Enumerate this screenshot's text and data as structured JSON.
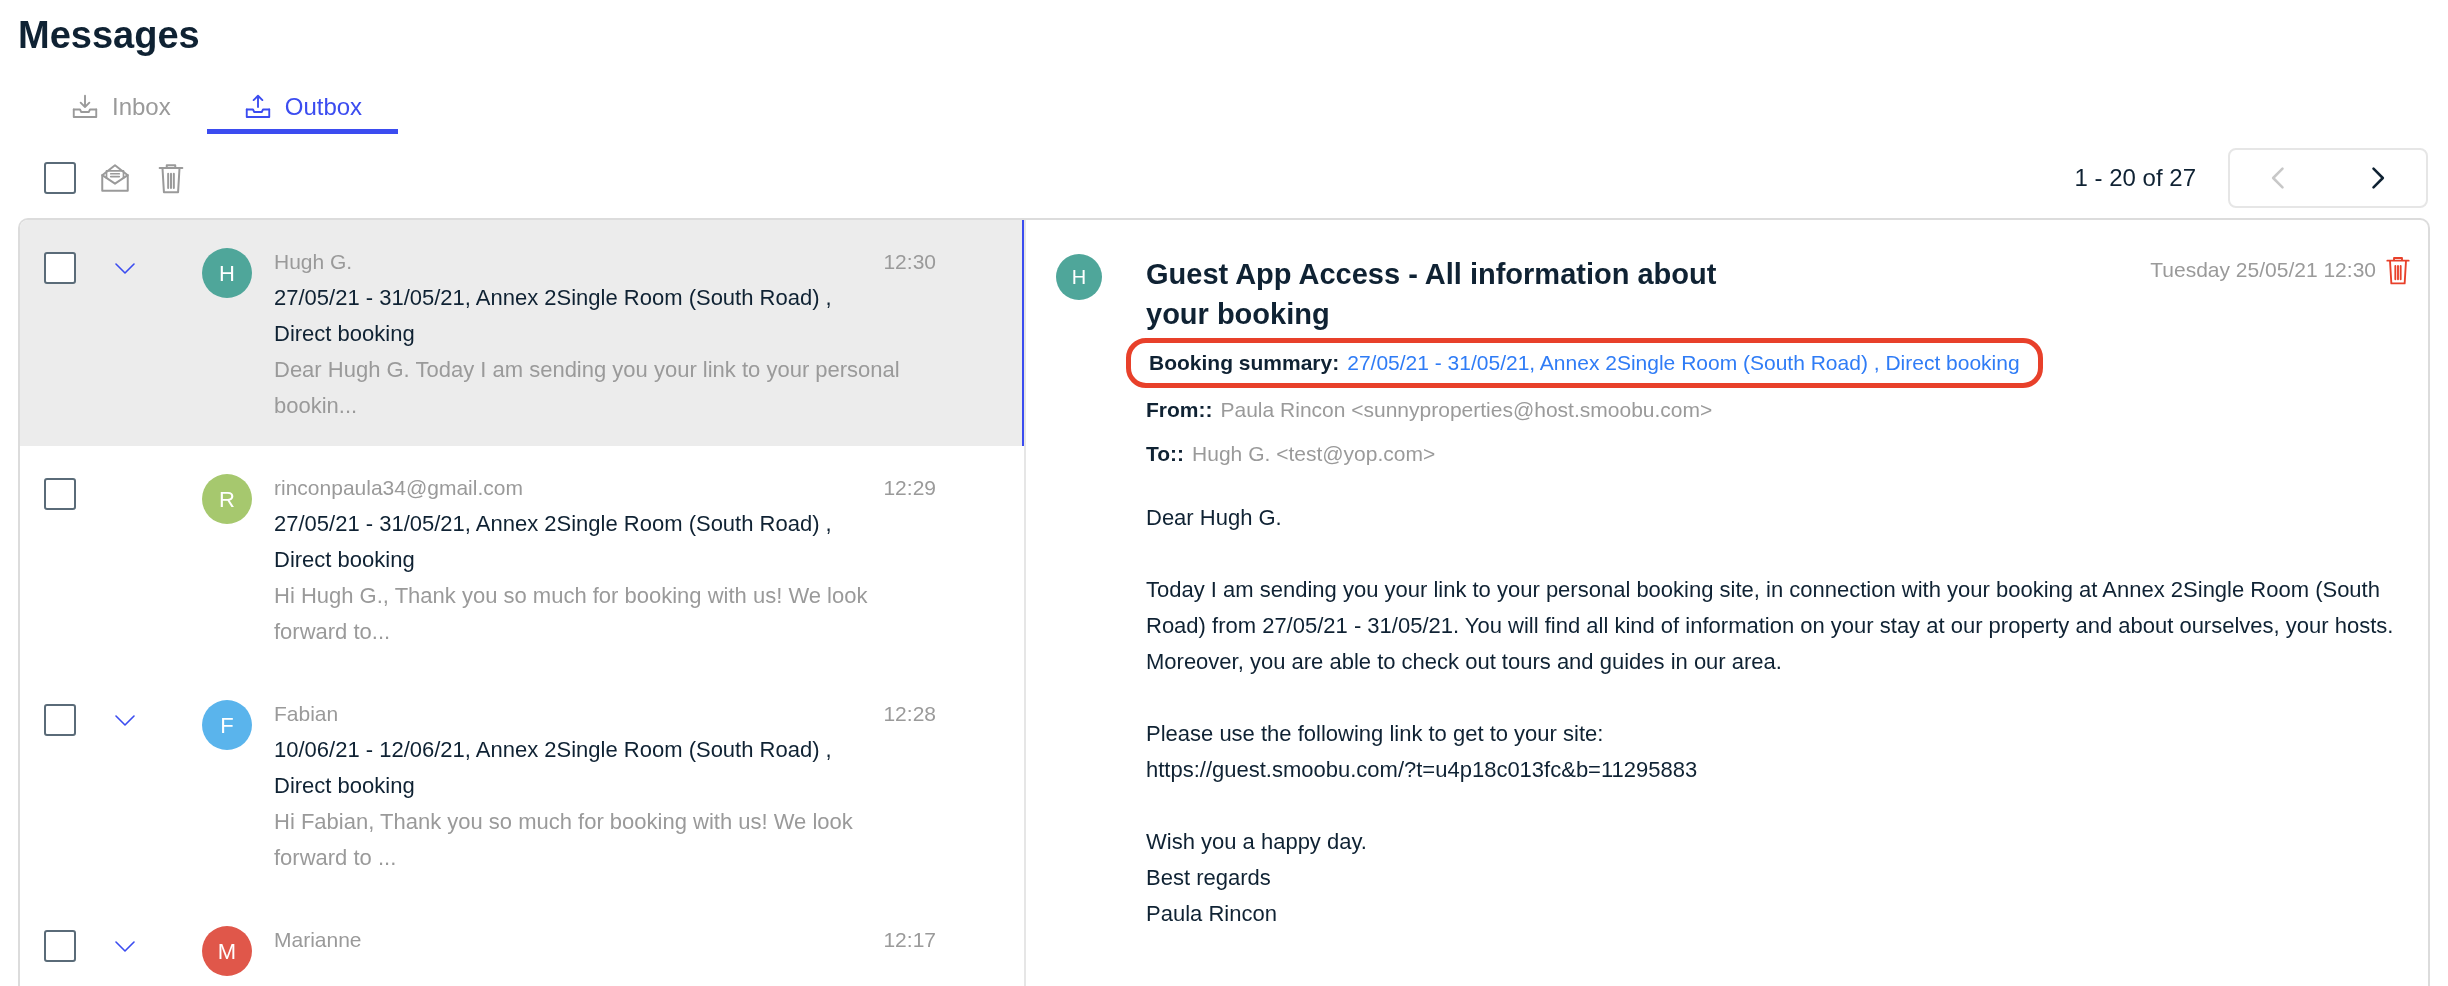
{
  "page_title": "Messages",
  "tabs": [
    {
      "label": "Inbox",
      "kind": "inbox",
      "selected": false
    },
    {
      "label": "Outbox",
      "kind": "outbox",
      "selected": true
    }
  ],
  "toolbar": {
    "select_all_checked": false
  },
  "pagination": {
    "range": "1 - 20 of 27",
    "prev_disabled": true,
    "next_disabled": false
  },
  "messages": [
    {
      "initial": "H",
      "color": "#4fa69a",
      "sender": "Hugh G.",
      "time": "12:30",
      "subject": "27/05/21 - 31/05/21, Annex 2Single Room (South Road) , Direct booking",
      "preview": "Dear Hugh G. Today I am sending you your link to your personal bookin...",
      "checked": false,
      "expandable": true,
      "selected": true
    },
    {
      "initial": "R",
      "color": "#a6c86e",
      "sender": "rinconpaula34@gmail.com",
      "time": "12:29",
      "subject": "27/05/21 - 31/05/21, Annex 2Single Room (South Road) , Direct booking",
      "preview": "Hi Hugh G., Thank you so much for booking with us! We look forward to...",
      "checked": false,
      "expandable": false,
      "selected": false
    },
    {
      "initial": "F",
      "color": "#5ab4ec",
      "sender": "Fabian",
      "time": "12:28",
      "subject": "10/06/21 - 12/06/21, Annex 2Single Room (South Road) , Direct booking",
      "preview": "Hi Fabian, Thank you so much for booking with us! We look forward to ...",
      "checked": false,
      "expandable": true,
      "selected": false
    },
    {
      "initial": "M",
      "color": "#e0574a",
      "sender": "Marianne",
      "time": "12:17",
      "checked": false,
      "expandable": true,
      "selected": false
    }
  ],
  "detail": {
    "initial": "H",
    "color": "#4fa69a",
    "subject": "Guest App Access - All information about your booking",
    "date": "Tuesday 25/05/21 12:30",
    "booking_summary": {
      "label": "Booking summary:",
      "value": "27/05/21 - 31/05/21, Annex 2Single Room (South Road) , Direct booking",
      "highlighted": true
    },
    "from": {
      "label": "From::",
      "value": "Paula Rincon <sunnyproperties@host.smoobu.com>"
    },
    "to": {
      "label": "To::",
      "value": "Hugh G. <test@yop.com>"
    },
    "body": [
      [
        "Dear Hugh G."
      ],
      [
        "Today I am sending you your link to your personal booking site, in connection with your booking at Annex 2Single Room (South Road) from 27/05/21 - 31/05/21. You will find all kind of information on your stay at our property and about ourselves, your hosts. Moreover, you are able to check out tours and guides in our area."
      ],
      [
        "Please use the following link to get to your site:",
        "https://guest.smoobu.com/?t=u4p18c013fc&b=11295883"
      ],
      [
        "Wish you a happy day.",
        "Best regards",
        "Paula Rincon"
      ]
    ]
  }
}
